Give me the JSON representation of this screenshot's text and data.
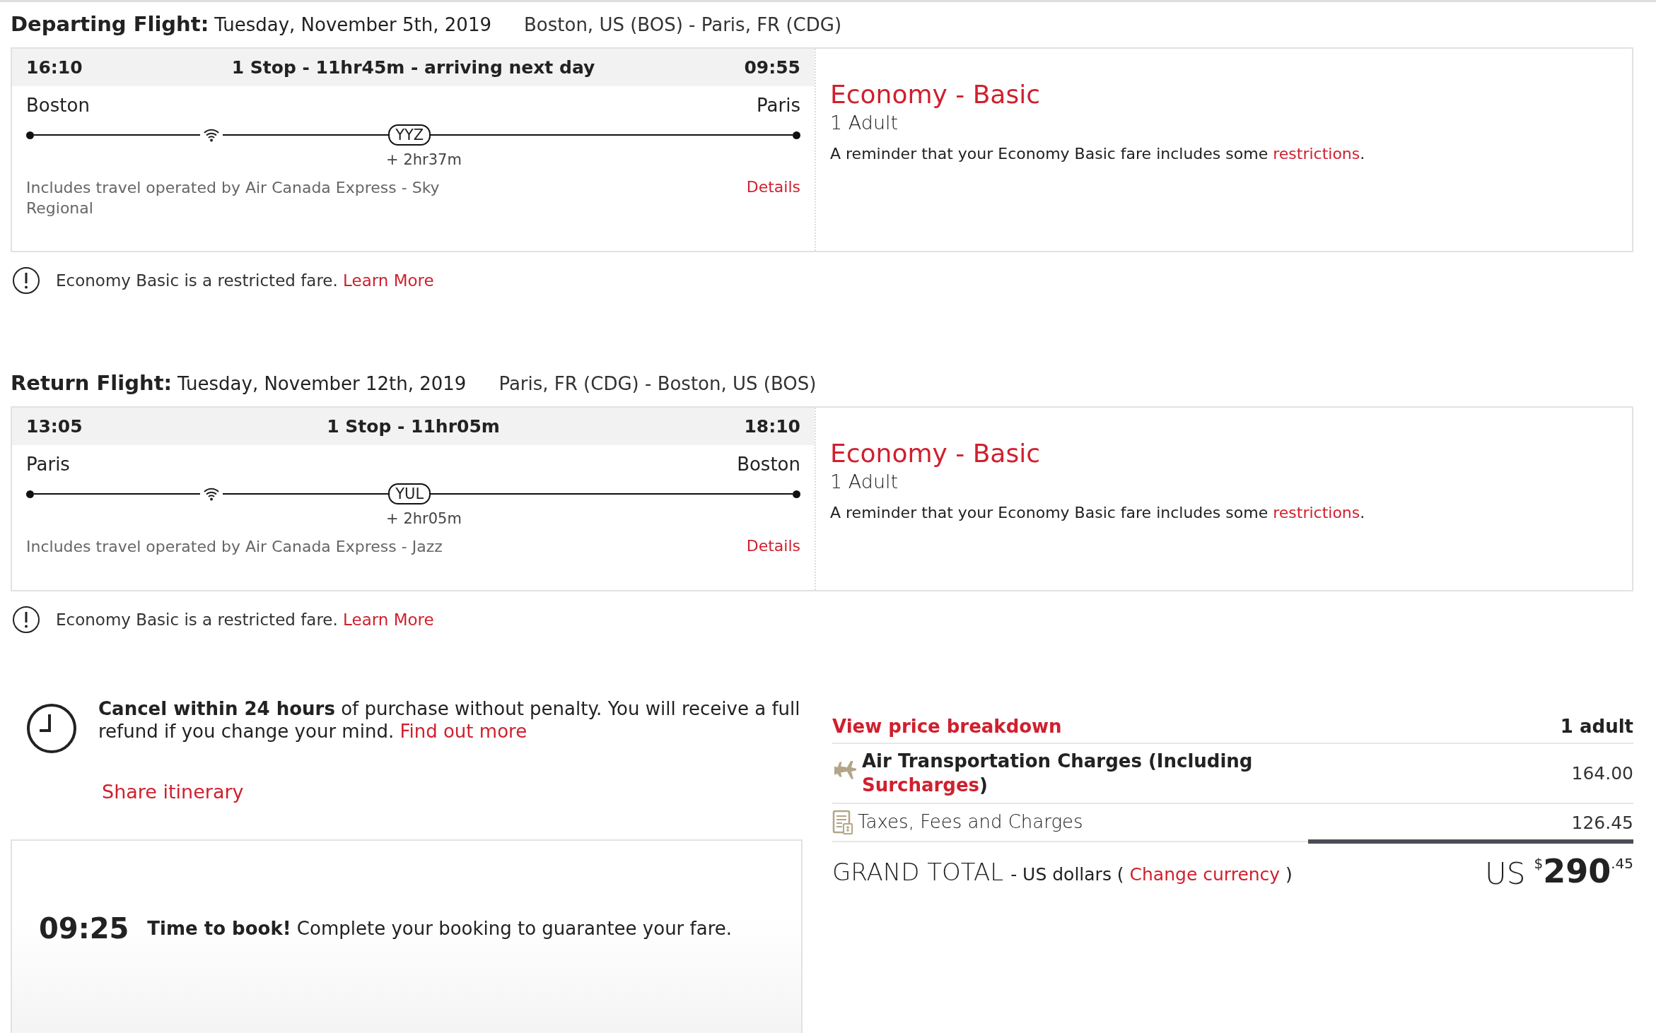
{
  "flights": [
    {
      "label": "Departing Flight:",
      "date": "Tuesday, November 5th, 2019",
      "route": "Boston, US (BOS) - Paris, FR (CDG)",
      "depart_time": "16:10",
      "summary": "1 Stop - 11hr45m - arriving next day",
      "arrive_time": "09:55",
      "origin": "Boston",
      "destination": "Paris",
      "stop_code": "YYZ",
      "layover": "+ 2hr37m",
      "operator": "Includes travel operated by Air Canada Express - Sky Regional",
      "details_link": "Details",
      "fare": {
        "name": "Economy - Basic",
        "passengers": "1 Adult",
        "reminder": "A reminder that your Economy Basic fare includes some",
        "reminder_link": "restrictions",
        "reminder_end": "."
      },
      "notice": {
        "text": "Economy Basic is a restricted fare.",
        "link": "Learn More"
      }
    },
    {
      "label": "Return Flight:",
      "date": "Tuesday, November 12th, 2019",
      "route": "Paris, FR (CDG) - Boston, US (BOS)",
      "depart_time": "13:05",
      "summary": "1 Stop - 11hr05m",
      "arrive_time": "18:10",
      "origin": "Paris",
      "destination": "Boston",
      "stop_code": "YUL",
      "layover": "+ 2hr05m",
      "operator": "Includes travel operated by Air Canada Express - Jazz",
      "details_link": "Details",
      "fare": {
        "name": "Economy - Basic",
        "passengers": "1 Adult",
        "reminder": "A reminder that your Economy Basic fare includes some",
        "reminder_link": "restrictions",
        "reminder_end": "."
      },
      "notice": {
        "text": "Economy Basic is a restricted fare.",
        "link": "Learn More"
      }
    }
  ],
  "cancel": {
    "text": "**Cancel within 24 hours** of purchase without penalty. You will receive a full refund if you change your mind.",
    "link": "Find out more"
  },
  "share_link": "Share itinerary",
  "timer": {
    "time": "09:25",
    "text": "**Time to book!** Complete your booking to guarantee your fare."
  },
  "price": {
    "breakdown_link": "View price breakdown",
    "passengers": "1 adult",
    "rows": [
      {
        "kind": "flight",
        "label": "Air Transportation Charges (Including",
        "link": "Surcharges",
        "label_end": ")",
        "amount": "164.00"
      },
      {
        "kind": "taxes",
        "label": "Taxes, Fees and Charges",
        "amount": "126.45"
      }
    ],
    "total": {
      "label": "GRAND TOTAL",
      "sub": "- US dollars (",
      "link": "Change currency",
      "sub_end": ")",
      "currency": "US",
      "symbol": "$",
      "whole": "290",
      "cents": ".45"
    }
  }
}
